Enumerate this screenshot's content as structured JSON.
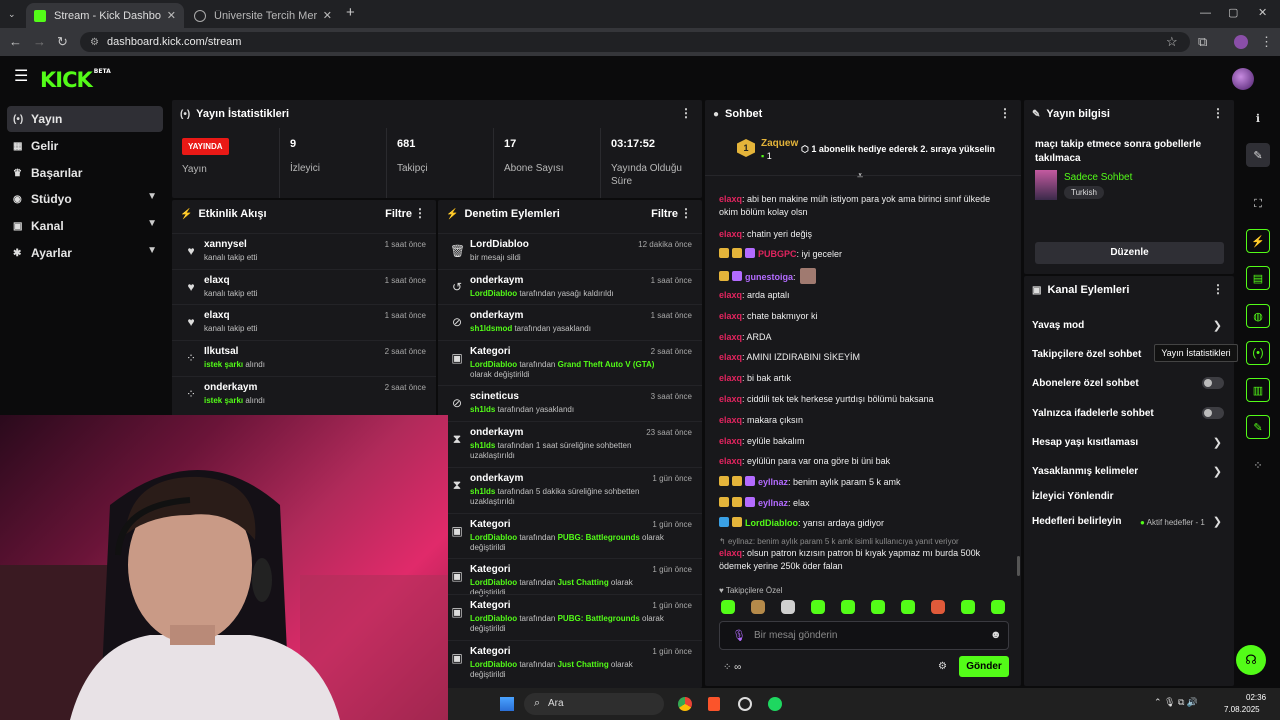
{
  "browser": {
    "tabs": [
      {
        "title": "Stream - Kick Dashboard",
        "active": true
      },
      {
        "title": "Üniversite Tercih Merkezi | Üniv",
        "active": false
      }
    ],
    "url": "dashboard.kick.com/stream"
  },
  "brand": {
    "logo": "KICK",
    "beta": "BETA",
    "accent": "#53fc18"
  },
  "sidebar": {
    "items": [
      {
        "label": "Yayın",
        "icon": "broadcast-icon",
        "active": true
      },
      {
        "label": "Gelir",
        "icon": "income-icon"
      },
      {
        "label": "Başarılar",
        "icon": "trophy-icon"
      },
      {
        "label": "Stüdyo",
        "icon": "studio-icon",
        "expandable": true
      },
      {
        "label": "Kanal",
        "icon": "channel-icon",
        "expandable": true
      },
      {
        "label": "Ayarlar",
        "icon": "settings-icon",
        "expandable": true
      }
    ]
  },
  "stats": {
    "title": "Yayın İstatistikleri",
    "live_badge": "YAYINDA",
    "live_label": "Yayın",
    "cells": [
      {
        "value": "9",
        "label": "İzleyici"
      },
      {
        "value": "681",
        "label": "Takipçi"
      },
      {
        "value": "17",
        "label": "Abone Sayısı"
      },
      {
        "value": "03:17:52",
        "label": "Yayında Olduğu Süre"
      }
    ]
  },
  "activity": {
    "title": "Etkinlik Akışı",
    "filter": "Filtre",
    "items": [
      {
        "name": "xannysel",
        "desc": "kanalı takip etti",
        "time": "1 saat önce",
        "icon": "heart-icon"
      },
      {
        "name": "elaxq",
        "desc": "kanalı takip etti",
        "time": "1 saat önce",
        "icon": "heart-icon"
      },
      {
        "name": "elaxq",
        "desc": "kanalı takip etti",
        "time": "1 saat önce",
        "icon": "heart-icon"
      },
      {
        "name": "Ilkutsal",
        "desc_hl": "istek şarkı",
        "desc": " alındı",
        "time": "2 saat önce",
        "icon": "song-request-icon"
      },
      {
        "name": "onderkaym",
        "desc_hl": "istek şarkı",
        "desc": " alındı",
        "time": "2 saat önce",
        "icon": "song-request-icon"
      }
    ]
  },
  "moderation": {
    "title": "Denetim Eylemleri",
    "filter": "Filtre",
    "items": [
      {
        "name": "LordDiabloo",
        "pre": "",
        "hl": "",
        "desc": "bir mesajı sildi",
        "hl2": "",
        "desc2": "",
        "time": "12 dakika önce",
        "icon": "trash-icon"
      },
      {
        "name": "onderkaym",
        "pre": "",
        "hl": "LordDiabloo",
        "desc": " tarafından yasağı kaldırıldı",
        "hl2": "",
        "desc2": "",
        "time": "1 saat önce",
        "icon": "unban-icon"
      },
      {
        "name": "onderkaym",
        "pre": "",
        "hl": "sh1ldsmod",
        "desc": " tarafından yasaklandı",
        "hl2": "",
        "desc2": "",
        "time": "1 saat önce",
        "icon": "ban-icon"
      },
      {
        "name": "Kategori",
        "pre": "",
        "hl": "LordDiabloo",
        "desc": " tarafından ",
        "hl2": "Grand Theft Auto V (GTA)",
        "desc2": " olarak değiştirildi",
        "time": "2 saat önce",
        "icon": "category-icon"
      },
      {
        "name": "scineticus",
        "pre": "",
        "hl": "sh1lds",
        "desc": " tarafından yasaklandı",
        "hl2": "",
        "desc2": "",
        "time": "3 saat önce",
        "icon": "ban-icon"
      },
      {
        "name": "onderkaym",
        "pre": "",
        "hl": "sh1lds",
        "desc": " tarafından 1 saat süreliğine sohbetten uzaklaştırıldı",
        "hl2": "",
        "desc2": "",
        "time": "23 saat önce",
        "icon": "timeout-icon"
      },
      {
        "name": "onderkaym",
        "pre": "",
        "hl": "sh1lds",
        "desc": " tarafından 5 dakika süreliğine sohbetten uzaklaştırıldı",
        "hl2": "",
        "desc2": "",
        "time": "1 gün önce",
        "icon": "timeout-icon"
      },
      {
        "name": "Kategori",
        "pre": "",
        "hl": "LordDiabloo",
        "desc": " tarafından ",
        "hl2": "PUBG: Battlegrounds",
        "desc2": " olarak değiştirildi",
        "time": "1 gün önce",
        "icon": "category-icon"
      },
      {
        "name": "Kategori",
        "pre": "",
        "hl": "LordDiabloo",
        "desc": " tarafından ",
        "hl2": "Just Chatting",
        "desc2": " olarak değiştirildi",
        "time": "1 gün önce",
        "icon": "category-icon"
      },
      {
        "name": "Kategori",
        "pre": "",
        "hl": "LordDiabloo",
        "desc": " tarafından ",
        "hl2": "PUBG: Battlegrounds",
        "desc2": " olarak değiştirildi",
        "time": "1 gün önce",
        "icon": "category-icon"
      },
      {
        "name": "Kategori",
        "pre": "",
        "hl": "LordDiabloo",
        "desc": " tarafından ",
        "hl2": "Just Chatting",
        "desc2": " olarak değiştirildi",
        "time": "1 gün önce",
        "icon": "category-icon"
      }
    ]
  },
  "chat": {
    "title": "Sohbet",
    "pinned": {
      "user": "Zaquew",
      "count": "1",
      "text": "1 abonelik hediye ederek 2. sıraya yükselin"
    },
    "messages": [
      {
        "user": "elaxq",
        "color": "#e0245e",
        "text": ": abi ben makine müh istiyom para yok ama birinci sınıf ülkede okim bölüm kolay olsn",
        "badges": []
      },
      {
        "user": "elaxq",
        "color": "#e0245e",
        "text": ": chatin yeri değiş",
        "badges": []
      },
      {
        "user": "PUBGPC",
        "color": "#e0245e",
        "text": ": iyi geceler",
        "badges": [
          "crown",
          "sub",
          "gem"
        ]
      },
      {
        "user": "gunestoiga",
        "color": "#b36bff",
        "text": ":",
        "badges": [
          "sub",
          "gem"
        ]
      },
      {
        "user": "elaxq",
        "color": "#e0245e",
        "text": ": arda aptalı",
        "badges": []
      },
      {
        "user": "elaxq",
        "color": "#e0245e",
        "text": ": chate bakmıyor ki",
        "badges": []
      },
      {
        "user": "elaxq",
        "color": "#e0245e",
        "text": ": ARDA",
        "badges": []
      },
      {
        "user": "elaxq",
        "color": "#e0245e",
        "text": ": AMINI IZDIRABINI SİKEYİM",
        "badges": []
      },
      {
        "user": "elaxq",
        "color": "#e0245e",
        "text": ": bi bak artık",
        "badges": []
      },
      {
        "user": "elaxq",
        "color": "#e0245e",
        "text": ": ciddili tek tek herkese yurtdışı bölümü baksana",
        "badges": []
      },
      {
        "user": "elaxq",
        "color": "#e0245e",
        "text": ": makara çıksın",
        "badges": []
      },
      {
        "user": "elaxq",
        "color": "#e0245e",
        "text": ": eylüle bakalım",
        "badges": []
      },
      {
        "user": "elaxq",
        "color": "#e0245e",
        "text": ": eylülün para var ona göre bi üni bak",
        "badges": []
      },
      {
        "user": "eyllnaz",
        "color": "#b36bff",
        "text": ": benim aylık param 5 k amk",
        "badges": [
          "crown",
          "gift",
          "gem"
        ]
      },
      {
        "user": "eyllnaz",
        "color": "#b36bff",
        "text": ": elax",
        "badges": [
          "crown",
          "gift",
          "gem"
        ]
      },
      {
        "user": "LordDiabloo",
        "color": "#53fc18",
        "text": ": yarısı ardaya gidiyor",
        "badges": [
          "mod",
          "sub"
        ]
      }
    ],
    "reply_ref": "eyllnaz: benim aylık param 5 k amk isimli kullanıcıya yanıt veriyor",
    "reply_msg": {
      "user": "elaxq",
      "text": ": olsun patron kızısın patron bi kıyak yapmaz mı burda 500k ödemek yerine 250k öder falan"
    },
    "followers_only": "Takipçilere Özel",
    "placeholder": "Bir mesaj gönderin",
    "send": "Gönder"
  },
  "stream_info": {
    "title": "Yayın bilgisi",
    "stream_title": "maçı takip etmece sonra gobellerle takılmaca",
    "category": "Sadece Sohbet",
    "tag": "Turkish",
    "edit": "Düzenle"
  },
  "channel_actions": {
    "title": "Kanal Eylemleri",
    "rows": [
      {
        "label": "Yavaş mod",
        "control": "chevron"
      },
      {
        "label": "Takipçilere özel sohbet",
        "control": "none"
      },
      {
        "label": "Abonelere özel sohbet",
        "control": "toggle"
      },
      {
        "label": "Yalnızca ifadelerle sohbet",
        "control": "toggle"
      },
      {
        "label": "Hesap yaşı kısıtlaması",
        "control": "chevron"
      },
      {
        "label": "Yasaklanmış kelimeler",
        "control": "chevron"
      },
      {
        "label": "İzleyici Yönlendir",
        "control": "none"
      },
      {
        "label": "Hedefleri belirleyin",
        "control": "chevron",
        "extra": "Aktif hedefler - 1"
      }
    ]
  },
  "tooltip": "Yayın İstatistikleri",
  "taskbar": {
    "search": "Ara",
    "time": "02:36",
    "date": "7.08.2025"
  }
}
